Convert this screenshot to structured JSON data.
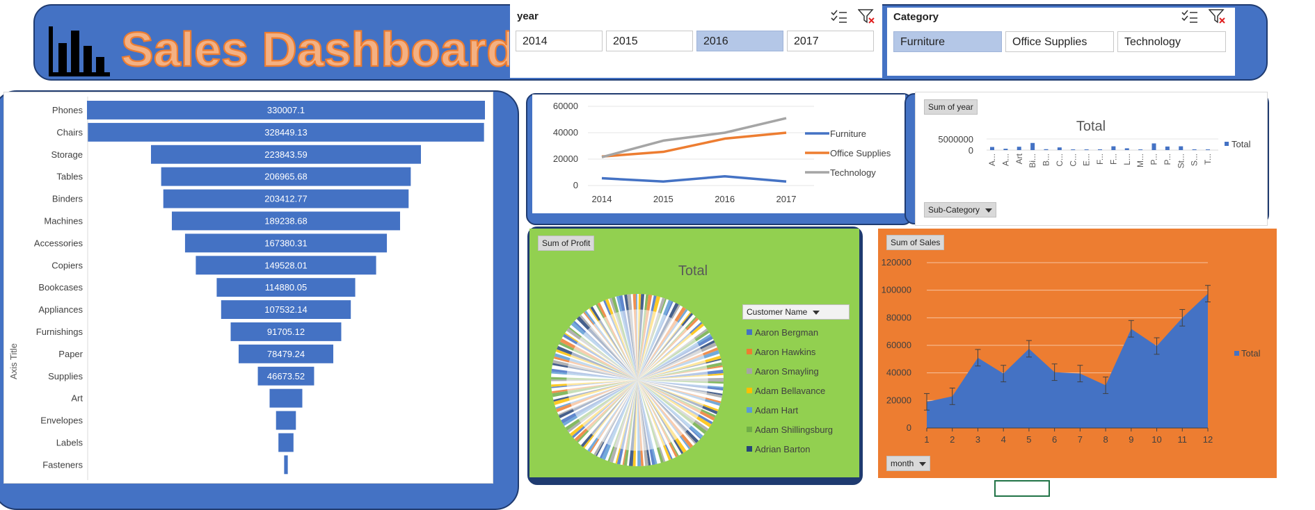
{
  "header": {
    "title": "Sales Dashboard",
    "colors": {
      "panel": "#4472c4",
      "title_fill": "#f4b183",
      "title_stroke": "#ed7d31"
    }
  },
  "slicers": {
    "year": {
      "title": "year",
      "options": [
        "2014",
        "2015",
        "2016",
        "2017"
      ],
      "selected": "2016"
    },
    "category": {
      "title": "Category",
      "options": [
        "Furniture",
        "Office Supplies",
        "Technology"
      ],
      "selected": "Furniture"
    }
  },
  "charts": {
    "funnel": {
      "type": "bar",
      "ylabel": "Axis Title",
      "categories": [
        "Phones",
        "Chairs",
        "Storage",
        "Tables",
        "Binders",
        "Machines",
        "Accessories",
        "Copiers",
        "Bookcases",
        "Appliances",
        "Furnishings",
        "Paper",
        "Supplies",
        "Art",
        "Envelopes",
        "Labels",
        "Fasteners"
      ],
      "values": [
        330007.1,
        328449.13,
        223843.59,
        206965.68,
        203412.77,
        189238.68,
        167380.31,
        149528.01,
        114880.05,
        107532.14,
        91705.12,
        78479.24,
        46673.52,
        27118,
        16476,
        12486,
        3024
      ],
      "labels": [
        "330007.1",
        "328449.13",
        "223843.59",
        "206965.68",
        "203412.77",
        "189238.68",
        "167380.31",
        "149528.01",
        "114880.05",
        "107532.14",
        "91705.12",
        "78479.24",
        "46673.52",
        "",
        "",
        "",
        ""
      ],
      "color": "#4472c4"
    },
    "line": {
      "type": "line",
      "x": [
        "2014",
        "2015",
        "2016",
        "2017"
      ],
      "y_ticks": [
        "0",
        "20000",
        "40000",
        "60000"
      ],
      "ylim": [
        0,
        60000
      ],
      "series": [
        {
          "name": "Furniture",
          "color": "#4472c4",
          "values": [
            5500,
            3000,
            7000,
            3000
          ]
        },
        {
          "name": "Office Supplies",
          "color": "#ed7d31",
          "values": [
            22000,
            25500,
            35500,
            40000
          ]
        },
        {
          "name": "Technology",
          "color": "#a5a5a5",
          "values": [
            21500,
            34000,
            40000,
            51000
          ]
        }
      ]
    },
    "subcat": {
      "type": "bar",
      "field_button": "Sum of year",
      "title": "Total",
      "legend": "Total",
      "axis_button": "Sub-Category",
      "y_ticks": [
        "5000000",
        "0"
      ],
      "ylim": [
        0,
        5000000
      ],
      "categories": [
        "A...",
        "A...",
        "Art",
        "Bi...",
        "B...",
        "C...",
        "C...",
        "E...",
        "F...",
        "F...",
        "L...",
        "M...",
        "P...",
        "P...",
        "St...",
        "S...",
        "T..."
      ],
      "values": [
        1400000,
        600000,
        1500000,
        3200000,
        400000,
        1200000,
        200000,
        150000,
        350000,
        1700000,
        800000,
        250000,
        3000000,
        1600000,
        1700000,
        350000,
        120000
      ]
    },
    "pie": {
      "type": "pie",
      "field_button": "Sum of Profit",
      "title": "Total",
      "legend_button": "Customer Name",
      "legend": [
        {
          "name": "Aaron Bergman",
          "color": "#4472c4"
        },
        {
          "name": "Aaron Hawkins",
          "color": "#ed7d31"
        },
        {
          "name": "Aaron Smayling",
          "color": "#a5a5a5"
        },
        {
          "name": "Adam Bellavance",
          "color": "#ffc000"
        },
        {
          "name": "Adam Hart",
          "color": "#5b9bd5"
        },
        {
          "name": "Adam Shillingsburg",
          "color": "#70ad47"
        },
        {
          "name": "Adrian Barton",
          "color": "#264478"
        }
      ],
      "background": "#92d050"
    },
    "area": {
      "type": "area",
      "field_button": "Sum of Sales",
      "legend": "Total",
      "axis_button": "month",
      "x": [
        "1",
        "2",
        "3",
        "4",
        "5",
        "6",
        "7",
        "8",
        "9",
        "10",
        "11",
        "12"
      ],
      "y_ticks": [
        "0",
        "20000",
        "40000",
        "60000",
        "80000",
        "100000",
        "120000"
      ],
      "ylim": [
        0,
        120000
      ],
      "values": [
        19000,
        23000,
        51000,
        39500,
        57500,
        40500,
        39500,
        31000,
        72000,
        59500,
        80000,
        97500
      ],
      "errors": [
        6000,
        6000,
        6000,
        6000,
        6000,
        6000,
        6000,
        6000,
        6000,
        6000,
        6000,
        6000
      ],
      "background": "#ed7d31",
      "fill": "#4472c4"
    }
  }
}
